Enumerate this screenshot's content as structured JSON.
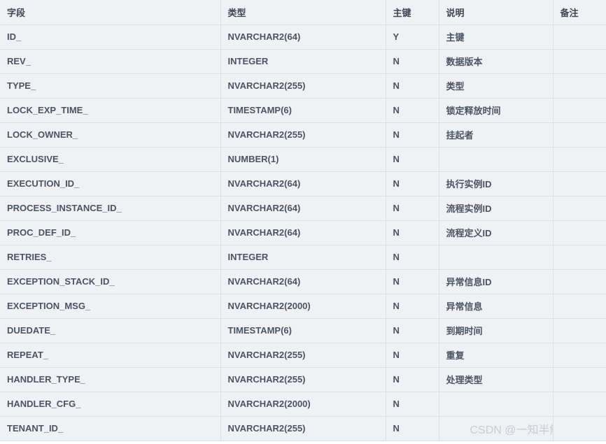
{
  "table": {
    "columns": [
      {
        "key": "field",
        "label": "字段"
      },
      {
        "key": "type",
        "label": "类型"
      },
      {
        "key": "pk",
        "label": "主键"
      },
      {
        "key": "desc",
        "label": "说明"
      },
      {
        "key": "remark",
        "label": "备注"
      }
    ],
    "rows": [
      {
        "field": "ID_",
        "type": "NVARCHAR2(64)",
        "pk": "Y",
        "desc": "主键",
        "remark": ""
      },
      {
        "field": "REV_",
        "type": "INTEGER",
        "pk": "N",
        "desc": "数据版本",
        "remark": ""
      },
      {
        "field": "TYPE_",
        "type": "NVARCHAR2(255)",
        "pk": "N",
        "desc": "类型",
        "remark": ""
      },
      {
        "field": "LOCK_EXP_TIME_",
        "type": "TIMESTAMP(6)",
        "pk": "N",
        "desc": "锁定释放时间",
        "remark": ""
      },
      {
        "field": "LOCK_OWNER_",
        "type": "NVARCHAR2(255)",
        "pk": "N",
        "desc": "挂起者",
        "remark": ""
      },
      {
        "field": "EXCLUSIVE_",
        "type": "NUMBER(1)",
        "pk": "N",
        "desc": "",
        "remark": ""
      },
      {
        "field": "EXECUTION_ID_",
        "type": "NVARCHAR2(64)",
        "pk": "N",
        "desc": "执行实例ID",
        "remark": ""
      },
      {
        "field": "PROCESS_INSTANCE_ID_",
        "type": "NVARCHAR2(64)",
        "pk": "N",
        "desc": "流程实例ID",
        "remark": ""
      },
      {
        "field": "PROC_DEF_ID_",
        "type": "NVARCHAR2(64)",
        "pk": "N",
        "desc": "流程定义ID",
        "remark": ""
      },
      {
        "field": "RETRIES_",
        "type": "INTEGER",
        "pk": "N",
        "desc": "",
        "remark": ""
      },
      {
        "field": "EXCEPTION_STACK_ID_",
        "type": "NVARCHAR2(64)",
        "pk": "N",
        "desc": "异常信息ID",
        "remark": ""
      },
      {
        "field": "EXCEPTION_MSG_",
        "type": "NVARCHAR2(2000)",
        "pk": "N",
        "desc": "异常信息",
        "remark": ""
      },
      {
        "field": "DUEDATE_",
        "type": "TIMESTAMP(6)",
        "pk": "N",
        "desc": "到期时间",
        "remark": ""
      },
      {
        "field": "REPEAT_",
        "type": "NVARCHAR2(255)",
        "pk": "N",
        "desc": "重复",
        "remark": ""
      },
      {
        "field": "HANDLER_TYPE_",
        "type": "NVARCHAR2(255)",
        "pk": "N",
        "desc": "处理类型",
        "remark": ""
      },
      {
        "field": "HANDLER_CFG_",
        "type": "NVARCHAR2(2000)",
        "pk": "N",
        "desc": "",
        "remark": ""
      },
      {
        "field": "TENANT_ID_",
        "type": "NVARCHAR2(255)",
        "pk": "N",
        "desc": "",
        "remark": ""
      }
    ]
  },
  "watermark": {
    "text": "CSDN @一知半解仙"
  },
  "colors": {
    "cell_background": "#eff1f5",
    "border": "#dcdfe4",
    "text": "#4b5463",
    "watermark": "#c9ccd2"
  }
}
